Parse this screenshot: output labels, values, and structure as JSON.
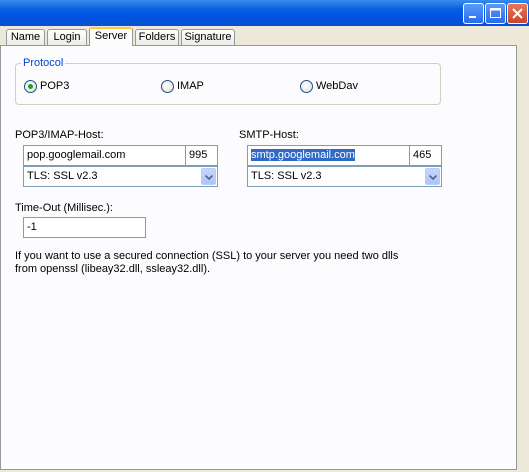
{
  "window": {
    "controls": {
      "minimize_icon": "minimize-icon",
      "maximize_icon": "maximize-icon",
      "close_icon": "close-icon"
    },
    "colors": {
      "title_bar": "#0054e3",
      "legend": "#0046d5",
      "selection": "#316ac5",
      "tab_highlight": "#ffc83c"
    }
  },
  "tabs": [
    {
      "label": "Name"
    },
    {
      "label": "Login"
    },
    {
      "label": "Server",
      "active": true
    },
    {
      "label": "Folders"
    },
    {
      "label": "Signature"
    }
  ],
  "protocol": {
    "legend": "Protocol",
    "options": [
      {
        "label": "POP3",
        "selected": true
      },
      {
        "label": "IMAP",
        "selected": false
      },
      {
        "label": "WebDav",
        "selected": false
      }
    ]
  },
  "incoming": {
    "label": "POP3/IMAP-Host:",
    "host": "pop.googlemail.com",
    "port": "995",
    "security": "TLS: SSL v2.3"
  },
  "outgoing": {
    "label": "SMTP-Host:",
    "host": "smtp.googlemail.com",
    "port": "465",
    "security": "TLS: SSL v2.3"
  },
  "timeout": {
    "label": "Time-Out (Millisec.):",
    "value": "-1"
  },
  "info": {
    "line1": "If you want to use a secured connection (SSL) to your server you need two dlls",
    "line2": "from openssl (libeay32.dll, ssleay32.dll)."
  }
}
